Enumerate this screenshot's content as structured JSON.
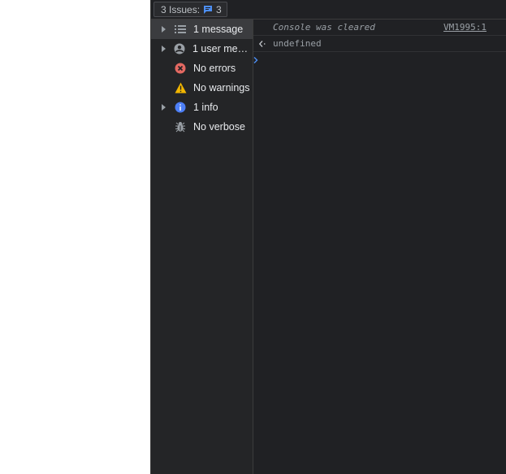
{
  "issues": {
    "label": "3 Issues:",
    "count": "3"
  },
  "sidebar": {
    "items": [
      {
        "label": "1 message",
        "icon": "list-icon",
        "expandable": true,
        "selected": true
      },
      {
        "label": "1 user mess…",
        "icon": "user-icon",
        "expandable": true,
        "selected": false
      },
      {
        "label": "No errors",
        "icon": "error-icon",
        "expandable": false,
        "selected": false
      },
      {
        "label": "No warnings",
        "icon": "warning-icon",
        "expandable": false,
        "selected": false
      },
      {
        "label": "1 info",
        "icon": "info-icon",
        "expandable": true,
        "selected": false
      },
      {
        "label": "No verbose",
        "icon": "bug-icon",
        "expandable": false,
        "selected": false
      }
    ]
  },
  "console": {
    "cleared_message": "Console was cleared",
    "cleared_source": "VM1995:1",
    "result_value": "undefined"
  },
  "colors": {
    "background": "#202124",
    "sidebar_selected": "#3b3c3f",
    "error": "#e46962",
    "warning": "#f2b600",
    "info": "#4d7ff6",
    "accent_blue": "#4d8ff5"
  }
}
